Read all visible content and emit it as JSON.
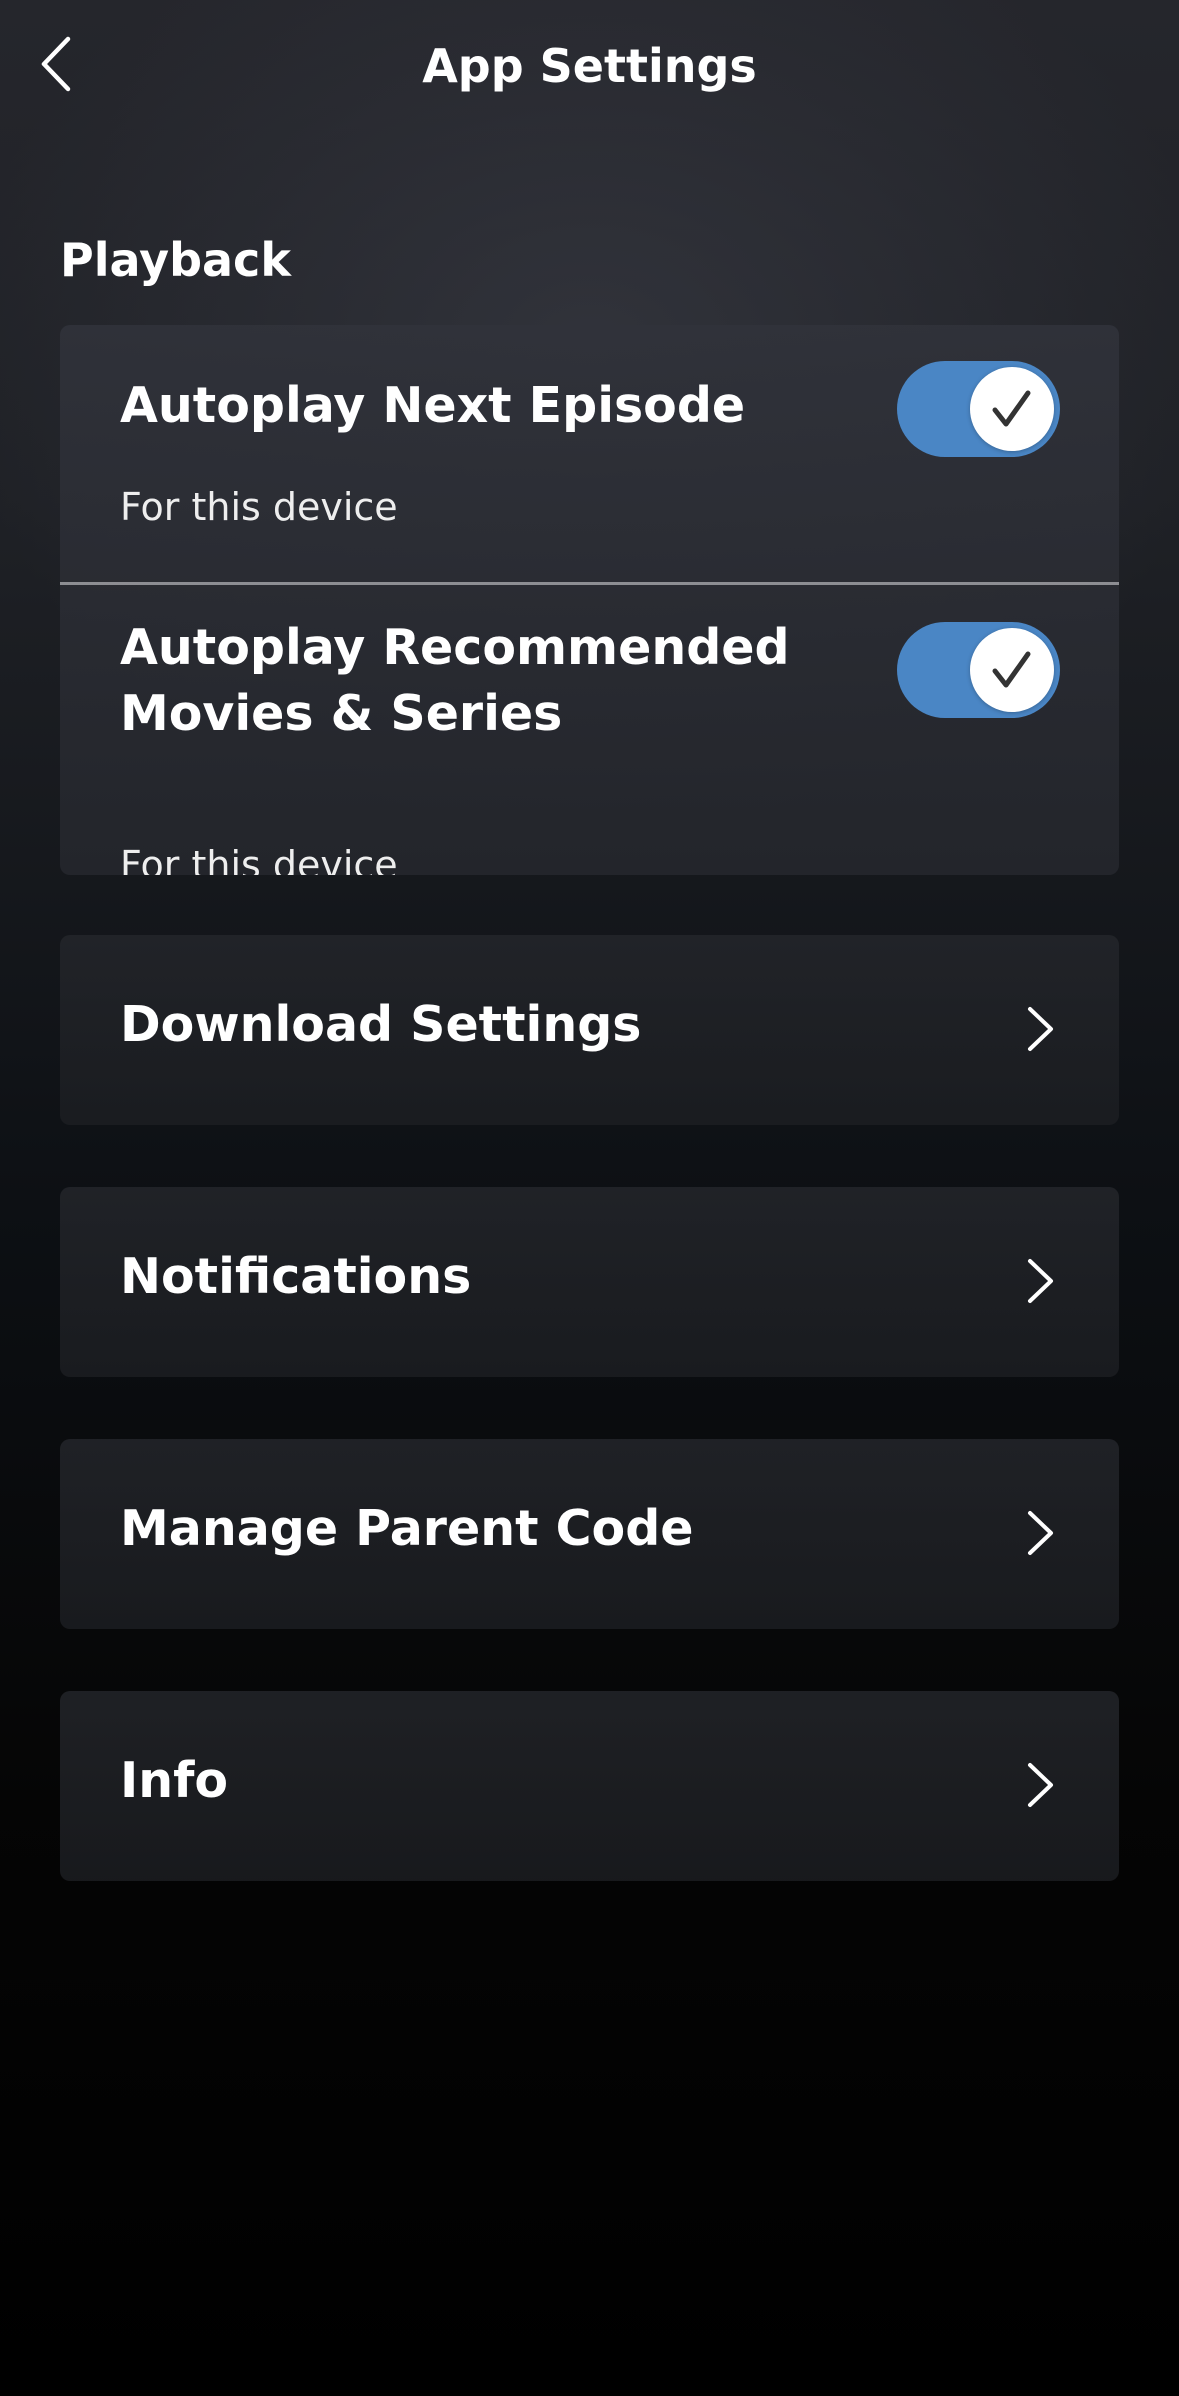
{
  "header": {
    "title": "App Settings"
  },
  "playback": {
    "section_title": "Playback",
    "items": [
      {
        "title": "Autoplay Next Episode",
        "subtitle": "For this device",
        "enabled": true
      },
      {
        "title": "Autoplay Recommended Movies & Series",
        "subtitle": "For this device",
        "enabled": true
      }
    ]
  },
  "menu": {
    "items": [
      {
        "label": "Download Settings"
      },
      {
        "label": "Notifications"
      },
      {
        "label": "Manage Parent Code"
      },
      {
        "label": "Info"
      }
    ]
  },
  "icons": {
    "back": "chevron-left-icon",
    "toggle_on": "checkmark-icon",
    "row_chevron": "chevron-right-icon"
  },
  "colors": {
    "accent_toggle": "#4a86c5",
    "text": "#ffffff",
    "background_top": "#25262c",
    "background_bottom": "#000000"
  }
}
